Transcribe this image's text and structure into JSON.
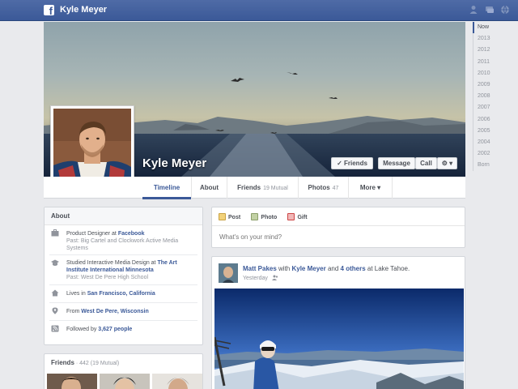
{
  "topbar": {
    "logo_letter": "f",
    "name": "Kyle Meyer",
    "icons": [
      "friends-icon",
      "messages-icon",
      "globe-icon"
    ]
  },
  "profile": {
    "name": "Kyle Meyer",
    "buttons": {
      "friends": "✓ Friends",
      "message": "Message",
      "call": "Call",
      "settings": "⚙ ▾"
    }
  },
  "tabs": [
    {
      "label": "Timeline",
      "sub": ""
    },
    {
      "label": "About",
      "sub": ""
    },
    {
      "label": "Friends",
      "sub": "19 Mutual"
    },
    {
      "label": "Photos",
      "sub": "47"
    },
    {
      "label": "More ▾",
      "sub": ""
    }
  ],
  "years": [
    "Now",
    "2013",
    "2012",
    "2011",
    "2010",
    "2009",
    "2008",
    "2007",
    "2006",
    "2005",
    "2004",
    "2002",
    "Born"
  ],
  "about": {
    "heading": "About",
    "work": {
      "prefix": "Product Designer at ",
      "place": "Facebook",
      "past": "Past: Big Cartel and Clockwork Active Media Systems"
    },
    "school": {
      "prefix": "Studied Interactive Media Design at ",
      "place": "The Art Institute International Minnesota",
      "past": "Past: West De Pere High School"
    },
    "lives": {
      "prefix": "Lives in ",
      "place": "San Francisco, California"
    },
    "from": {
      "prefix": "From ",
      "place": "West De Pere, Wisconsin"
    },
    "followers": {
      "prefix": "Followed by ",
      "count": "3,627 people"
    }
  },
  "friends": {
    "heading": "Friends",
    "count": " · 442",
    "mutual": " (19 Mutual)"
  },
  "composer": {
    "post": "Post",
    "photo": "Photo",
    "gift": "Gift",
    "placeholder": "What's on your mind?"
  },
  "post": {
    "author": "Matt Pakes",
    "with": " with ",
    "tagged": "Kyle Meyer",
    "and": " and ",
    "others": "4 others",
    "at": " at Lake Tahoe.",
    "time": "Yesterday"
  },
  "colors": {
    "brand": "#3b5998",
    "link": "#3b5998",
    "bg": "#e9eaed"
  }
}
